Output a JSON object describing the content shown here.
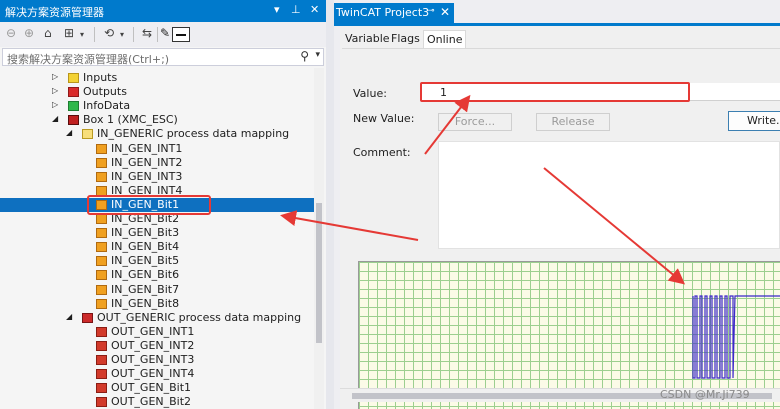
{
  "solution_explorer": {
    "title": "解决方案资源管理器",
    "title_controls": {
      "dropdown": "▾",
      "pin": "⊥",
      "close": "✕"
    },
    "search_placeholder": "搜索解决方案资源管理器(Ctrl+;)"
  },
  "tree": [
    {
      "label": "Inputs",
      "level": 5,
      "icon": "inputs-icon",
      "expander": "▷"
    },
    {
      "label": "Outputs",
      "level": 5,
      "icon": "outputs-icon",
      "expander": "▷"
    },
    {
      "label": "InfoData",
      "level": 5,
      "icon": "infodata-icon",
      "expander": "▷"
    },
    {
      "label": "Box 1 (XMC_ESC)",
      "level": 5,
      "icon": "box-icon",
      "expander": "◢"
    },
    {
      "label": "IN_GENERIC process data mapping",
      "level": 6,
      "icon": "mapping-in-icon",
      "expander": "◢"
    },
    {
      "label": "IN_GEN_INT1",
      "level": 7,
      "icon": "input-var-icon"
    },
    {
      "label": "IN_GEN_INT2",
      "level": 7,
      "icon": "input-var-icon"
    },
    {
      "label": "IN_GEN_INT3",
      "level": 7,
      "icon": "input-var-icon"
    },
    {
      "label": "IN_GEN_INT4",
      "level": 7,
      "icon": "input-var-icon"
    },
    {
      "label": "IN_GEN_Bit1",
      "level": 7,
      "icon": "input-var-icon",
      "selected": true
    },
    {
      "label": "IN_GEN_Bit2",
      "level": 7,
      "icon": "input-var-icon"
    },
    {
      "label": "IN_GEN_Bit3",
      "level": 7,
      "icon": "input-var-icon"
    },
    {
      "label": "IN_GEN_Bit4",
      "level": 7,
      "icon": "input-var-icon"
    },
    {
      "label": "IN_GEN_Bit5",
      "level": 7,
      "icon": "input-var-icon"
    },
    {
      "label": "IN_GEN_Bit6",
      "level": 7,
      "icon": "input-var-icon"
    },
    {
      "label": "IN_GEN_Bit7",
      "level": 7,
      "icon": "input-var-icon"
    },
    {
      "label": "IN_GEN_Bit8",
      "level": 7,
      "icon": "input-var-icon"
    },
    {
      "label": "OUT_GENERIC process data mapping",
      "level": 6,
      "icon": "mapping-out-icon",
      "expander": "◢"
    },
    {
      "label": "OUT_GEN_INT1",
      "level": 7,
      "icon": "output-var-icon"
    },
    {
      "label": "OUT_GEN_INT2",
      "level": 7,
      "icon": "output-var-icon"
    },
    {
      "label": "OUT_GEN_INT3",
      "level": 7,
      "icon": "output-var-icon"
    },
    {
      "label": "OUT_GEN_INT4",
      "level": 7,
      "icon": "output-var-icon"
    },
    {
      "label": "OUT_GEN_Bit1",
      "level": 7,
      "icon": "output-var-icon"
    },
    {
      "label": "OUT_GEN_Bit2",
      "level": 7,
      "icon": "output-var-icon"
    }
  ],
  "document": {
    "tab_title": "TwinCAT Project3",
    "tab_pin": "⊸",
    "tab_close": "✕",
    "tabs": [
      "Variable",
      "Flags",
      "Online"
    ],
    "active_tab": "Online",
    "value_label": "Value:",
    "value": "1",
    "new_value_label": "New Value:",
    "force_label": "Force...",
    "release_label": "Release",
    "write_label": "Write...",
    "comment_label": "Comment:"
  },
  "colors": {
    "accent": "#007acc",
    "selection": "#0e70c0",
    "annotation_red": "#e53935",
    "trace": "#3b27c9"
  },
  "watermark": "CSDN @Mr.Ji739"
}
